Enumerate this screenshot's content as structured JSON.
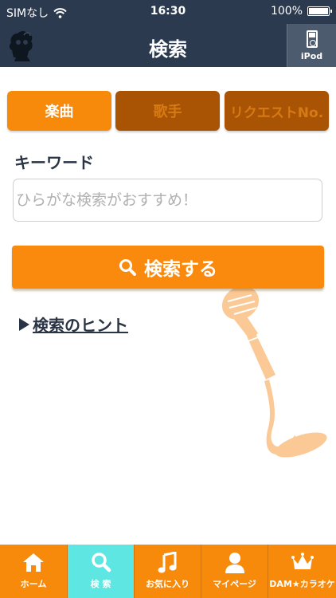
{
  "status_bar": {
    "carrier": "SIMなし",
    "time": "16:30",
    "battery": "100%"
  },
  "nav": {
    "title": "検索",
    "ipod_label": "iPod"
  },
  "segments": [
    {
      "label": "楽曲",
      "active": true
    },
    {
      "label": "歌手",
      "active": false
    },
    {
      "label": "リクエストNo.",
      "active": false
    }
  ],
  "keyword": {
    "label": "キーワード",
    "placeholder": "ひらがな検索がおすすめ！",
    "value": ""
  },
  "search_button": {
    "label": "検索する"
  },
  "hint": {
    "label": "検索のヒント"
  },
  "tabs": [
    {
      "label": "ホーム",
      "icon": "home-icon",
      "active": false
    },
    {
      "label": "検 索",
      "icon": "search-icon",
      "active": true
    },
    {
      "label": "お気に入り",
      "icon": "music-note-icon",
      "active": false
    },
    {
      "label": "マイページ",
      "icon": "person-icon",
      "active": false
    },
    {
      "label": "DAM★カラオケ",
      "icon": "crown-icon",
      "active": false
    }
  ],
  "colors": {
    "header": "#2b3a4e",
    "accent": "#f88a0b",
    "segment_inactive": "#a95304",
    "tab_active": "#5ee6e2"
  }
}
